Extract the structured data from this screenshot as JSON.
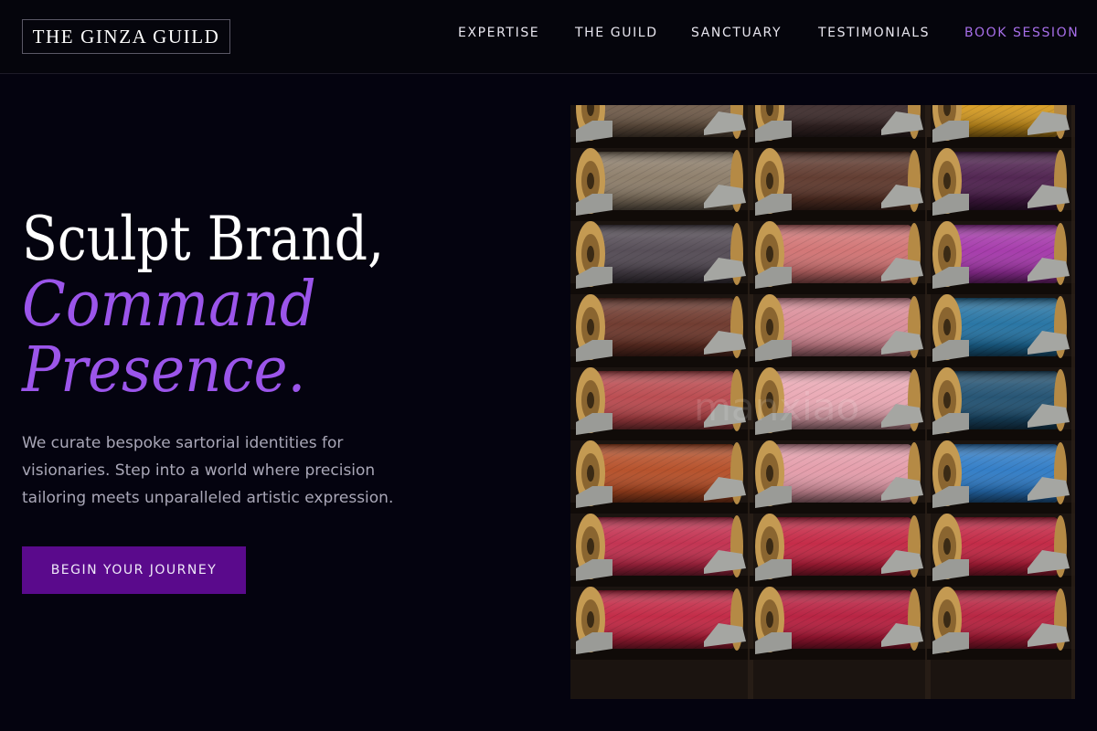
{
  "header": {
    "logo": "THE GINZA GUILD",
    "nav": [
      {
        "label": "EXPERTISE"
      },
      {
        "label": "THE GUILD"
      },
      {
        "label": "SANCTUARY"
      },
      {
        "label": "TESTIMONIALS"
      },
      {
        "label": "BOOK SESSION",
        "accent": true
      }
    ]
  },
  "hero": {
    "headline_line1": "Sculpt Brand,",
    "headline_line2": "Command",
    "headline_line3": "Presence.",
    "description": "We curate bespoke sartorial identities for visionaries. Step into a world where precision tailoring meets unparalleled artistic expression.",
    "cta_label": "BEGIN YOUR JOURNEY",
    "image_subject": "thread spools on a rack",
    "watermark": "manxiao"
  },
  "colors": {
    "background": "#04030f",
    "accent_purple": "#9b55ea",
    "nav_accent": "#a66ee8",
    "cta_background": "#5a0a8c",
    "body_text": "#a9a7b7"
  }
}
